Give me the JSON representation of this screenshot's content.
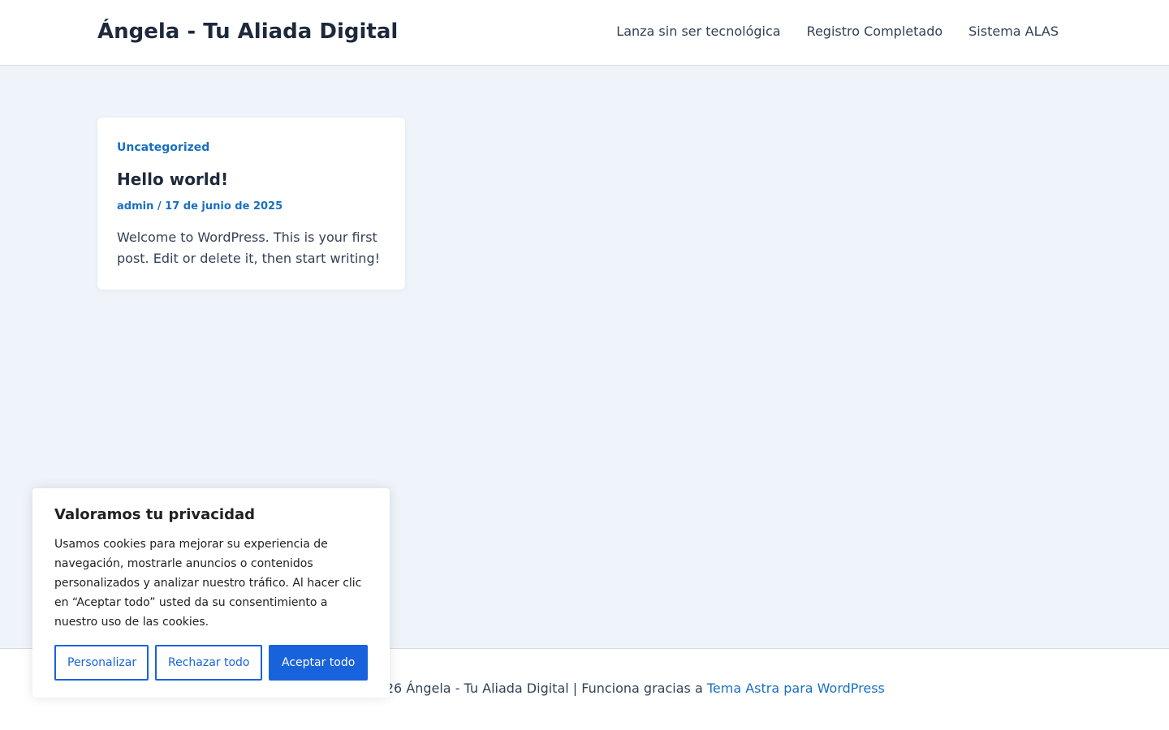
{
  "header": {
    "site_title": "Ángela - Tu Aliada Digital",
    "nav": [
      {
        "label": "Lanza sin ser tecnológica"
      },
      {
        "label": "Registro Completado"
      },
      {
        "label": "Sistema ALAS"
      }
    ]
  },
  "post": {
    "category": "Uncategorized",
    "title": "Hello world!",
    "author": "admin",
    "separator": " / ",
    "date": "17 de junio de 2025",
    "excerpt": "Welcome to WordPress. This is your first post. Edit or delete it, then start writing!"
  },
  "footer": {
    "copyright_text": "Copyright © 2026 Ángela - Tu Aliada Digital | Funciona gracias a ",
    "theme_link": "Tema Astra para WordPress"
  },
  "cookie_banner": {
    "title": "Valoramos tu privacidad",
    "text": "Usamos cookies para mejorar su experiencia de navegación, mostrarle anuncios o contenidos personalizados y analizar nuestro tráfico. Al hacer clic en “Aceptar todo” usted da su consentimiento a nuestro uso de las cookies.",
    "customize_label": "Personalizar",
    "reject_label": "Rechazar todo",
    "accept_label": "Aceptar todo"
  },
  "colors": {
    "accent": "#1a6fbf",
    "cookie_button": "#1863dc",
    "page_background": "#eff4fa"
  }
}
